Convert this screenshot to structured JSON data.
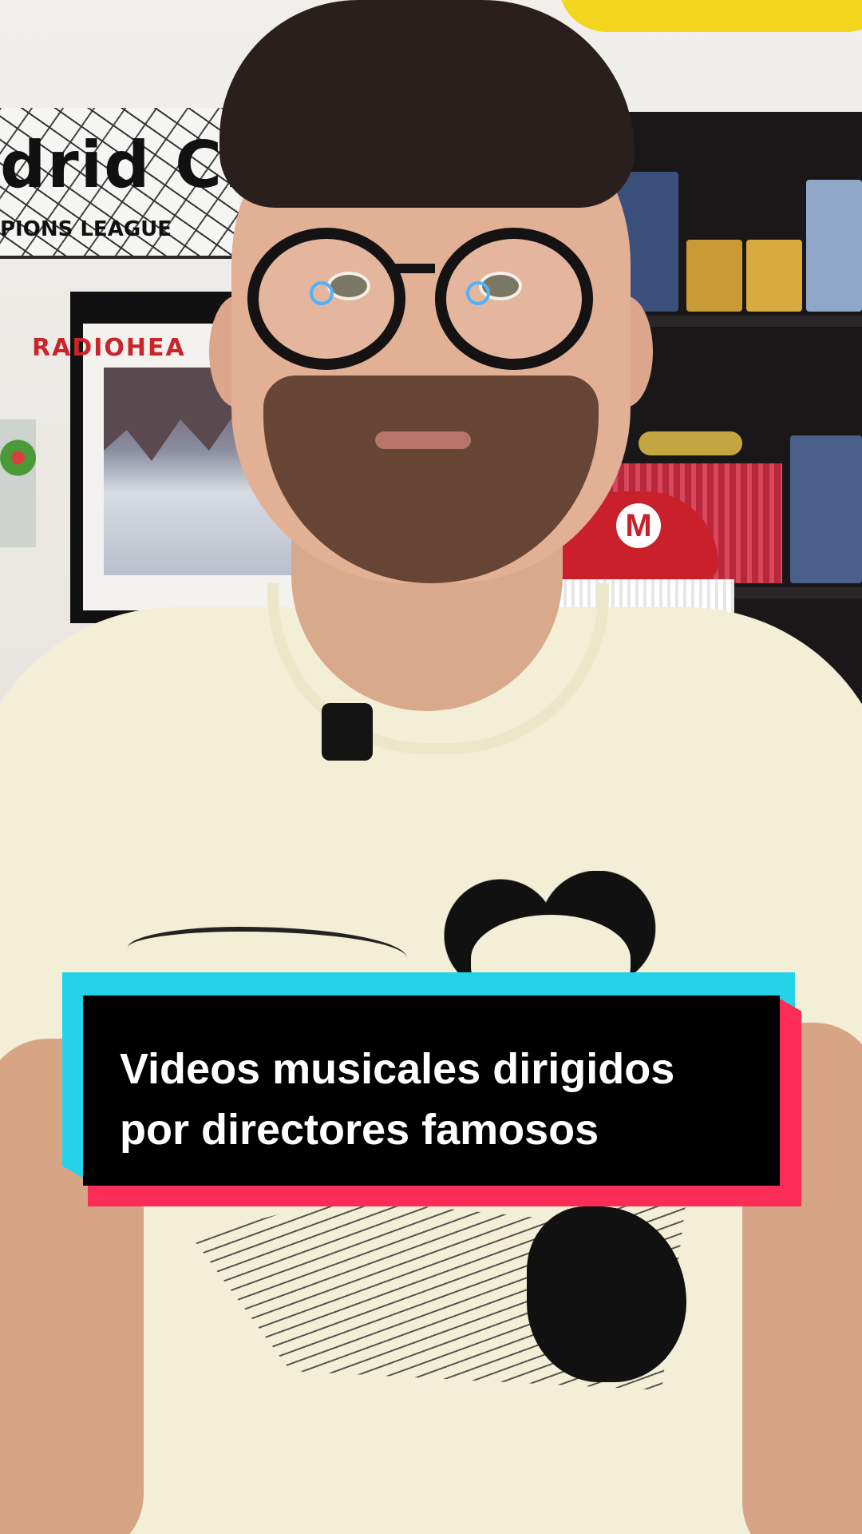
{
  "background": {
    "scarf_text": "drid C.",
    "scarf_subtext": "PIONS LEAGUE",
    "poster_title": "RADIOHEA",
    "cap_logo": "M"
  },
  "caption": {
    "line1": "Videos musicales dirigidos",
    "line2": "por directores famosos"
  },
  "colors": {
    "caption_bg": "#000000",
    "caption_cyan": "#25d3e8",
    "caption_red": "#fb2c55",
    "caption_text": "#ffffff"
  }
}
